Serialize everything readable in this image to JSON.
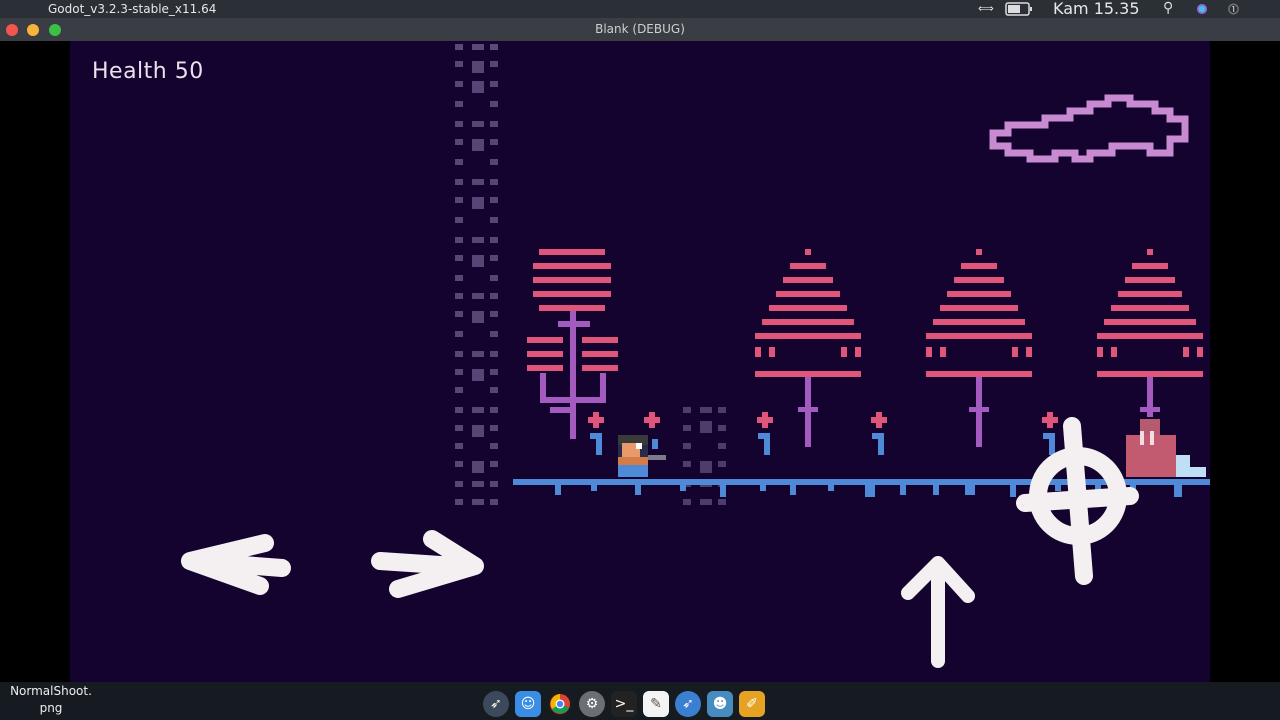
{
  "menubar": {
    "app_title": "Godot_v3.2.3-stable_x11.64",
    "clock": "Kam 15.35"
  },
  "window": {
    "title": "Blank (DEBUG)"
  },
  "game": {
    "health_label": "Health 50"
  },
  "dock": {
    "file_label_line1": "NormalShoot.",
    "file_label_line2": "png"
  },
  "colors": {
    "viewport_bg": "#14032f",
    "ground": "#4f8ad8",
    "tree_red": "#e0557a",
    "tree_purple": "#a35bbf",
    "cloud": "#c88ad0",
    "pillar": "#5a4a7a",
    "controls": "#f4f0f2"
  },
  "icons": [
    "apple-icon",
    "search-icon",
    "battery-icon",
    "rocket-icon",
    "finder-icon",
    "chrome-icon",
    "settings-icon",
    "terminal-icon",
    "notes-icon",
    "fish-icon",
    "godot-icon",
    "pages-icon"
  ]
}
